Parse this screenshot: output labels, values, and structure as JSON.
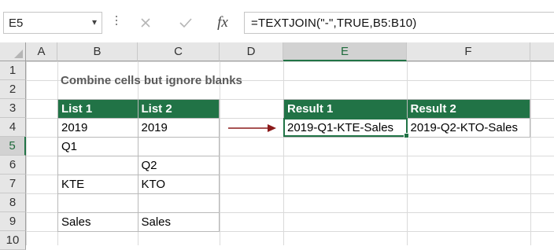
{
  "formula_bar": {
    "name_box": "E5",
    "formula": "=TEXTJOIN(\"-\",TRUE,B5:B10)",
    "cancel_icon": "close-icon",
    "enter_icon": "check-icon",
    "function_icon": "fx-icon"
  },
  "columns": [
    "A",
    "B",
    "C",
    "D",
    "E",
    "F"
  ],
  "rows": [
    "1",
    "2",
    "3",
    "4",
    "5",
    "6",
    "7",
    "8",
    "9",
    "10"
  ],
  "sheet": {
    "title": "Combine cells but ignore blanks",
    "list_table": {
      "headers": [
        "List 1",
        "List 2"
      ],
      "rows": [
        [
          "2019",
          "2019"
        ],
        [
          "Q1",
          ""
        ],
        [
          "",
          "Q2"
        ],
        [
          "KTE",
          "KTO"
        ],
        [
          "",
          ""
        ],
        [
          "Sales",
          "Sales"
        ]
      ]
    },
    "result_table": {
      "headers": [
        "Result 1",
        "Result 2"
      ],
      "values": [
        "2019-Q1-KTE-Sales",
        "2019-Q2-KTO-Sales"
      ]
    }
  },
  "colors": {
    "header_green": "#217346",
    "arrow": "#8b1a1a"
  }
}
